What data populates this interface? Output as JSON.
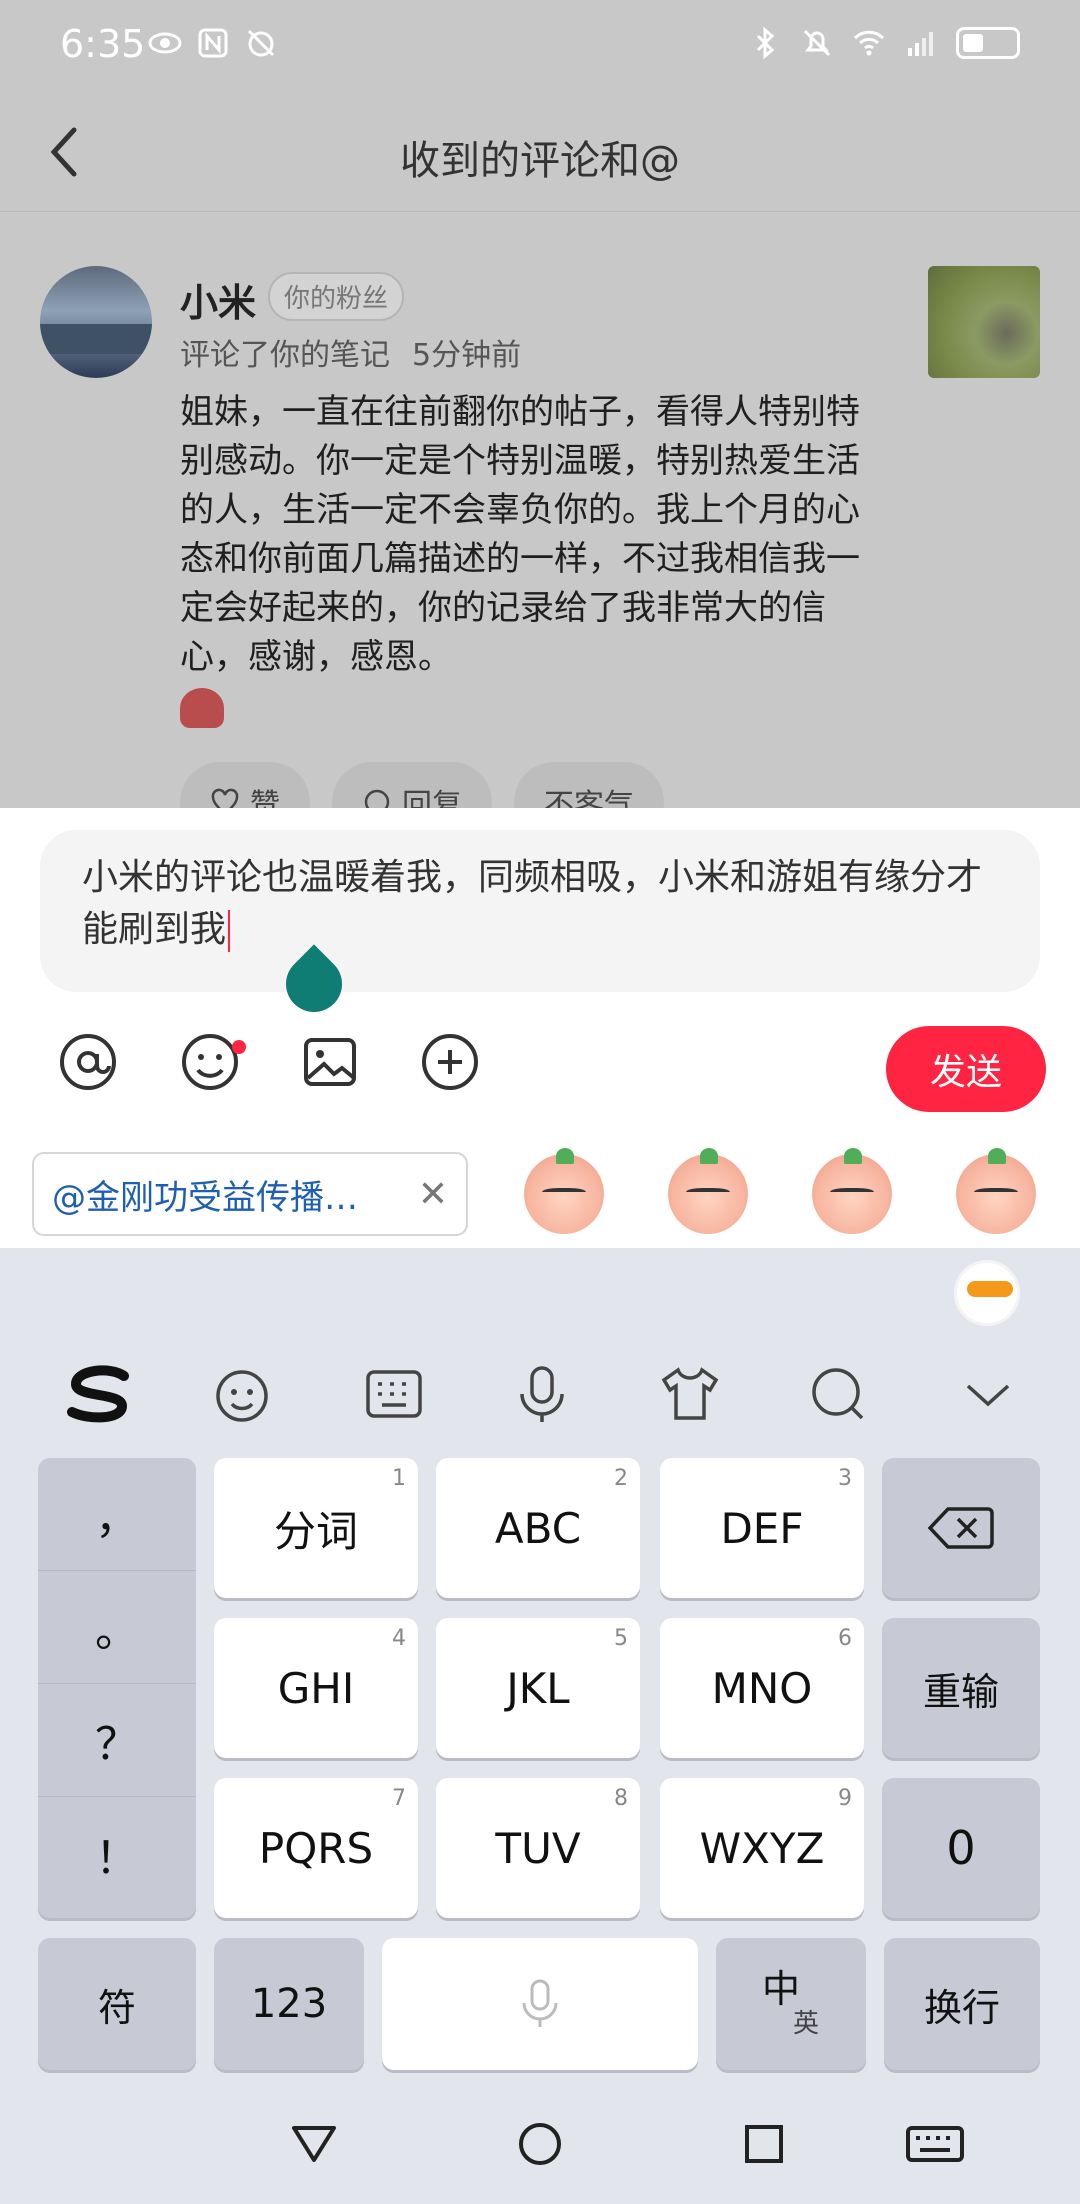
{
  "status_bar": {
    "time": "6:35"
  },
  "header": {
    "title": "收到的评论和@"
  },
  "comment": {
    "username": "小米",
    "badge": "你的粉丝",
    "action": "评论了你的笔记",
    "time_ago": "5分钟前",
    "text": "姐妹，一直在往前翻你的帖子，看得人特别特别感动。你一定是个特别温暖，特别热爱生活的人，生活一定不会辜负你的。我上个月的心态和你前面几篇描述的一样，不过我相信我一定会好起来的，你的记录给了我非常大的信心，感谢，感恩。",
    "actions": [
      "赞",
      "回复",
      "不客气"
    ]
  },
  "reply": {
    "value": "小米的评论也温暖着我，同频相吸，小米和游姐有缘分才能刷到我",
    "send_label": "发送",
    "mention_chip": "@金刚功受益传播…"
  },
  "keyboard": {
    "punctuation": [
      "，",
      "。",
      "？",
      "！"
    ],
    "row1": [
      {
        "label": "分词",
        "num": "1"
      },
      {
        "label": "ABC",
        "num": "2"
      },
      {
        "label": "DEF",
        "num": "3"
      }
    ],
    "row2": [
      {
        "label": "GHI",
        "num": "4"
      },
      {
        "label": "JKL",
        "num": "5"
      },
      {
        "label": "MNO",
        "num": "6"
      }
    ],
    "row3": [
      {
        "label": "PQRS",
        "num": "7"
      },
      {
        "label": "TUV",
        "num": "8"
      },
      {
        "label": "WXYZ",
        "num": "9"
      }
    ],
    "reinput": "重输",
    "zero": "0",
    "symbol": "符",
    "numbers": "123",
    "lang_main": "中",
    "lang_sub": "英",
    "enter": "换行"
  }
}
